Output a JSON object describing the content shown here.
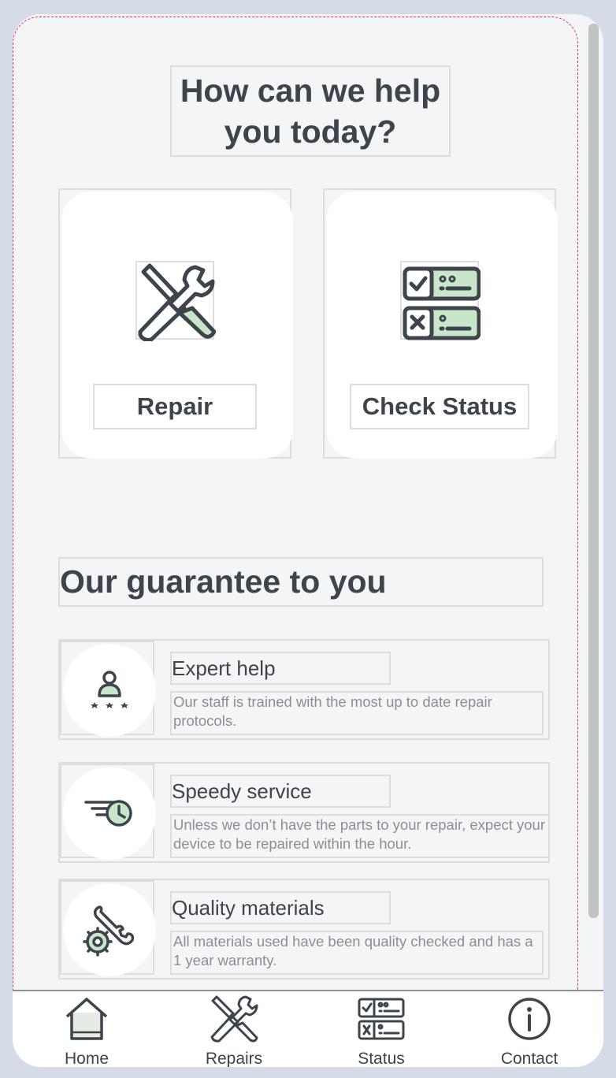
{
  "headline": "How can we help you today?",
  "cards": [
    {
      "label": "Repair",
      "icon": "repair-tools-icon"
    },
    {
      "label": "Check Status",
      "icon": "status-checklist-icon"
    }
  ],
  "guarantee": {
    "title": "Our guarantee to you",
    "items": [
      {
        "title": "Expert help",
        "desc": "Our staff is trained with the most up to date repair protocols.",
        "icon": "expert-person-icon"
      },
      {
        "title": "Speedy service",
        "desc": "Unless we don’t have the parts to your repair, expect your device to be repaired within the hour.",
        "icon": "speed-clock-icon"
      },
      {
        "title": "Quality materials",
        "desc": "All materials used have been quality checked and has a 1 year warranty.",
        "icon": "gear-wrench-icon"
      }
    ]
  },
  "nav": [
    {
      "label": "Home",
      "icon": "home-icon"
    },
    {
      "label": "Repairs",
      "icon": "tools-icon"
    },
    {
      "label": "Status",
      "icon": "status-icon"
    },
    {
      "label": "Contact",
      "icon": "info-icon"
    }
  ],
  "colors": {
    "accent": "#c8e6c9",
    "text": "#3e444c",
    "muted": "#8a8f96",
    "background": "#f4f5f7"
  }
}
